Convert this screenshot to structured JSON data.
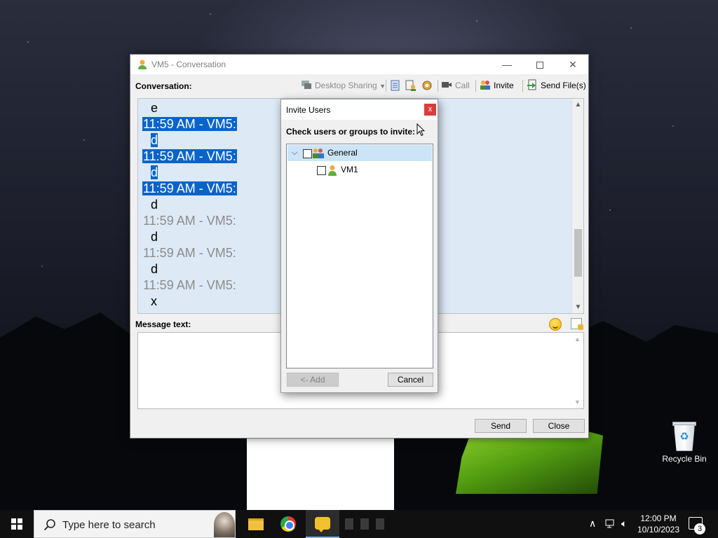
{
  "window": {
    "title": "VM5 - Conversation",
    "controls": {
      "minimize": "—",
      "close": "✕"
    }
  },
  "toolbar": {
    "conversation_label": "Conversation:",
    "desktop_sharing": "Desktop Sharing",
    "call": "Call",
    "invite": "Invite",
    "send_files": "Send File(s)"
  },
  "chat": {
    "lines": [
      {
        "kind": "msg",
        "text": "e",
        "selected": false
      },
      {
        "kind": "time",
        "text": "11:59 AM - VM5:",
        "selected": true
      },
      {
        "kind": "msg",
        "text": "d",
        "selected": true
      },
      {
        "kind": "time",
        "text": "11:59 AM - VM5:",
        "selected": true
      },
      {
        "kind": "msg",
        "text": "d",
        "selected": true
      },
      {
        "kind": "time",
        "text": "11:59 AM - VM5:",
        "selected": true
      },
      {
        "kind": "msg",
        "text": "d",
        "selected": false
      },
      {
        "kind": "time",
        "text": "11:59 AM - VM5:",
        "selected": false
      },
      {
        "kind": "msg",
        "text": "d",
        "selected": false
      },
      {
        "kind": "time",
        "text": "11:59 AM - VM5:",
        "selected": false
      },
      {
        "kind": "msg",
        "text": "d",
        "selected": false
      },
      {
        "kind": "time",
        "text": "11:59 AM - VM5:",
        "selected": false
      },
      {
        "kind": "msg",
        "text": "x",
        "selected": false
      }
    ]
  },
  "message": {
    "label": "Message text:",
    "value": ""
  },
  "buttons": {
    "send": "Send",
    "close": "Close"
  },
  "invite_dialog": {
    "title": "Invite Users",
    "close_glyph": "x",
    "prompt": "Check users or groups to invite:",
    "tree": {
      "group": {
        "label": "General",
        "expanded": true,
        "checked": false
      },
      "users": [
        {
          "label": "VM1",
          "checked": false
        }
      ]
    },
    "add_label": "<- Add",
    "cancel_label": "Cancel"
  },
  "desktop": {
    "recycle_bin_label": "Recycle Bin"
  },
  "taskbar": {
    "search_placeholder": "Type here to search",
    "clock_time": "12:00 PM",
    "clock_date": "10/10/2023",
    "notification_count": "3"
  },
  "colors": {
    "selection": "#0a64c8",
    "chat_background": "#dde9f5",
    "tree_selected": "#cce4f7",
    "dialog_close": "#d83d3d"
  }
}
